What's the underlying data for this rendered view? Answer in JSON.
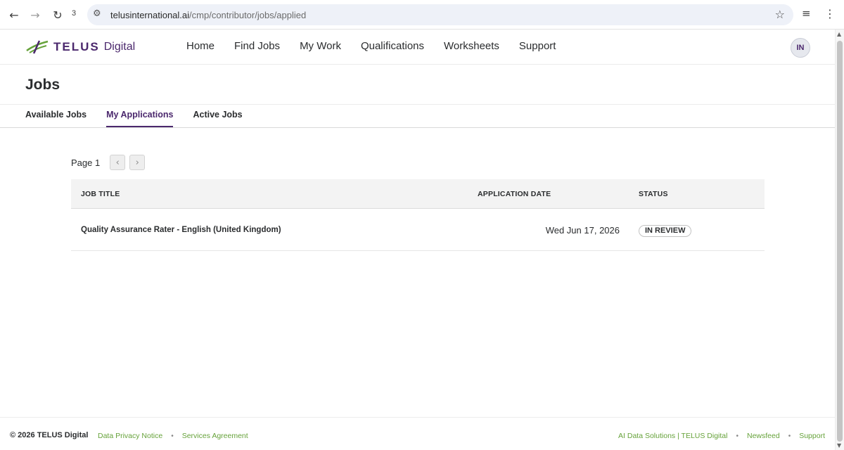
{
  "browser": {
    "tab_count": "3",
    "url_host": "telusinternational.ai",
    "url_path": "/cmp/contributor/jobs/applied",
    "icons": {
      "back": "arrow-left-icon",
      "forward": "arrow-right-icon",
      "reload": "reload-icon",
      "site_settings": "tune-icon",
      "bookmark": "star-icon",
      "media": "queue-music-icon",
      "menu": "kebab-menu-icon"
    }
  },
  "header": {
    "brand": "TELUS",
    "brand_suffix": "Digital",
    "nav": [
      {
        "label": "Home"
      },
      {
        "label": "Find Jobs"
      },
      {
        "label": "My Work"
      },
      {
        "label": "Qualifications"
      },
      {
        "label": "Worksheets"
      },
      {
        "label": "Support"
      }
    ],
    "avatar_initials": "IN"
  },
  "page": {
    "title": "Jobs",
    "tabs": [
      {
        "label": "Available Jobs",
        "active": false
      },
      {
        "label": "My Applications",
        "active": true
      },
      {
        "label": "Active Jobs",
        "active": false
      }
    ],
    "pagination": {
      "label": "Page 1",
      "prev_icon": "chevron-left-icon",
      "next_icon": "chevron-right-icon"
    },
    "table": {
      "columns": [
        "JOB TITLE",
        "APPLICATION DATE",
        "STATUS"
      ],
      "rows": [
        {
          "job_title": "Quality Assurance Rater - English (United Kingdom)",
          "application_date": "Wed Jun 17, 2026",
          "status": "IN REVIEW"
        }
      ]
    }
  },
  "footer": {
    "copyright": "© 2026 TELUS Digital",
    "left_links": [
      "Data Privacy Notice",
      "Services Agreement"
    ],
    "right_links": [
      "AI Data Solutions | TELUS Digital",
      "Newsfeed",
      "Support"
    ],
    "link_color": "#66a23a"
  },
  "colors": {
    "brand_purple": "#4b286d",
    "brand_green": "#66a23a"
  }
}
